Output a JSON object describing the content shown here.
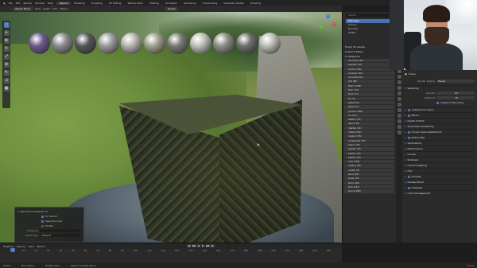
{
  "topbar": {
    "menus": [
      "File",
      "Edit",
      "Render",
      "Window",
      "Help"
    ],
    "workspaces": [
      "Layout",
      "Modeling",
      "Sculpting",
      "UV Editing",
      "Texture Paint",
      "Shading",
      "Animation",
      "Rendering",
      "Compositing",
      "Geometry Nodes",
      "Scripting"
    ],
    "active_workspace": "Layout"
  },
  "viewport_header": {
    "mode": "Object Mode",
    "menus": [
      "View",
      "Select",
      "Add",
      "Object"
    ],
    "orientation": "Global"
  },
  "operator_panel": {
    "title": "Blenderkit Asset Bar UI",
    "options": [
      {
        "label": "Do Search",
        "checked": true
      },
      {
        "label": "Keep Running",
        "checked": true
      },
      {
        "label": "Tooltip",
        "checked": false
      }
    ],
    "category_label": "Category",
    "category_value": "",
    "asset_type_label": "Asset Type",
    "asset_type_value": "Material"
  },
  "timeline": {
    "menus": [
      "Playback",
      "Keying",
      "View",
      "Marker"
    ],
    "current_frame": "1",
    "ticks": [
      "0",
      "10",
      "20",
      "30",
      "40",
      "50",
      "60",
      "70",
      "80",
      "90",
      "100",
      "110",
      "120",
      "130",
      "140",
      "150",
      "160",
      "170",
      "180",
      "190",
      "200",
      "210",
      "220",
      "230",
      "250"
    ],
    "play_controls": [
      "|◀",
      "◀◀",
      "◀",
      "▶",
      "▶▶",
      "▶|"
    ]
  },
  "status": {
    "items": [
      "Select",
      "Box Select",
      "Rotate View",
      "Object Context Menu"
    ],
    "version": "3.0.0"
  },
  "assets": {
    "search_placeholder": "Search",
    "tree": [
      "Materials",
      "Scenes",
      "Brushes",
      "HDRIs"
    ],
    "found_label": "Found 41 results",
    "filters_label": "Search Filters",
    "categories_label": "Categories",
    "categories": [
      {
        "label": "concrete (26)",
        "selected": false
      },
      {
        "label": "asphalt (18)",
        "selected": false
      },
      {
        "label": "bricks (126)",
        "selected": false
      },
      {
        "label": "ceramic (44)",
        "selected": false
      },
      {
        "label": "concrete (61)",
        "selected": false
      },
      {
        "label": "dirt (26)",
        "selected": false
      },
      {
        "label": "fabric (105)",
        "selected": false
      },
      {
        "label": "floor (74)",
        "selected": false
      },
      {
        "label": "food (17)",
        "selected": false
      },
      {
        "label": "fur (4)",
        "selected": false
      },
      {
        "label": "glass (53)",
        "selected": false
      },
      {
        "label": "glass (27)",
        "selected": false
      },
      {
        "label": "ground (104)",
        "selected": false
      },
      {
        "label": "ice (12)",
        "selected": false
      },
      {
        "label": "leather (27)",
        "selected": false
      },
      {
        "label": "liquid (14)",
        "selected": false
      },
      {
        "label": "marble (31)",
        "selected": false
      },
      {
        "label": "metal (232)",
        "selected": false
      },
      {
        "label": "organic (45)",
        "selected": false
      },
      {
        "label": "ornaments (33)",
        "selected": false
      },
      {
        "label": "paper (43)",
        "selected": false
      },
      {
        "label": "plaster (22)",
        "selected": false
      },
      {
        "label": "plastic (78)",
        "selected": false
      },
      {
        "label": "plastic (42)",
        "selected": false
      },
      {
        "label": "rock (102)",
        "selected": false
      },
      {
        "label": "roofing (34)",
        "selected": false
      },
      {
        "label": "rubber (8)",
        "selected": false
      },
      {
        "label": "sand (20)",
        "selected": false
      },
      {
        "label": "snow (11)",
        "selected": false
      },
      {
        "label": "stone (64)",
        "selected": false
      },
      {
        "label": "tiles (221)",
        "selected": false
      },
      {
        "label": "wood (186)",
        "selected": false
      }
    ]
  },
  "properties": {
    "scene_name": "Scene",
    "render_engine_label": "Render Engine",
    "render_engine_value": "Eevee",
    "sampling_label": "Sampling",
    "render_label": "Render",
    "render_value": "64",
    "viewport_label": "Viewport",
    "viewport_value": "16",
    "viewport_denoising": "Viewport Denoising",
    "sections": [
      {
        "label": "Ambient Occlusion",
        "checkbox": true
      },
      {
        "label": "Bloom",
        "checkbox": true
      },
      {
        "label": "Depth of Field",
        "checkbox": false
      },
      {
        "label": "Subsurface Scattering",
        "checkbox": false
      },
      {
        "label": "Screen Space Reflections",
        "checkbox": true
      },
      {
        "label": "Motion Blur",
        "checkbox": true
      },
      {
        "label": "Volumetrics",
        "checkbox": false
      },
      {
        "label": "Performance",
        "checkbox": false
      },
      {
        "label": "Curves",
        "checkbox": false
      },
      {
        "label": "Shadows",
        "checkbox": false
      },
      {
        "label": "Indirect Lighting",
        "checkbox": false
      },
      {
        "label": "Film",
        "checkbox": false
      },
      {
        "label": "Simplify",
        "checkbox": true
      },
      {
        "label": "Grease Pencil",
        "checkbox": false
      },
      {
        "label": "Freestyle",
        "checkbox": true
      },
      {
        "label": "Color Management",
        "checkbox": false
      }
    ]
  },
  "material_balls": [
    {
      "name": "purple-fabric",
      "color": "#6b5a8a"
    },
    {
      "name": "grey-plaster",
      "color": "#8a8a8a"
    },
    {
      "name": "dark-stone",
      "color": "#555"
    },
    {
      "name": "metal",
      "color": "#9a9a9a"
    },
    {
      "name": "concrete",
      "color": "#b5b5b0"
    },
    {
      "name": "gravel",
      "color": "#a0a08f"
    },
    {
      "name": "rough-rock",
      "color": "#7a7a74"
    },
    {
      "name": "pavement",
      "color": "#c0c0ba"
    },
    {
      "name": "asphalt",
      "color": "#8d8d88"
    },
    {
      "name": "grey-rock",
      "color": "#6f6f6c"
    },
    {
      "name": "fine-concrete",
      "color": "#bcbcb6"
    }
  ]
}
